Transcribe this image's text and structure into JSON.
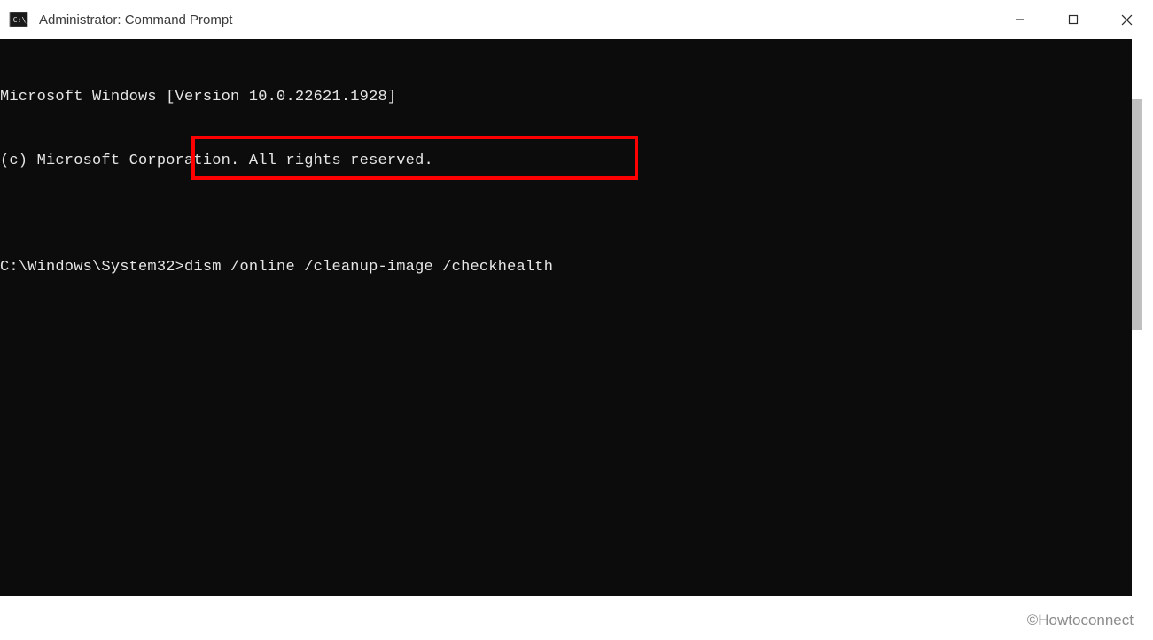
{
  "titlebar": {
    "icon_name": "cmd-icon",
    "title": "Administrator: Command Prompt"
  },
  "window_controls": {
    "minimize_name": "minimize-icon",
    "maximize_name": "maximize-icon",
    "close_name": "close-icon"
  },
  "terminal": {
    "lines": [
      "Microsoft Windows [Version 10.0.22621.1928]",
      "(c) Microsoft Corporation. All rights reserved.",
      "",
      "C:\\Windows\\System32>dism /online /cleanup-image /checkhealth"
    ],
    "prompt": "C:\\Windows\\System32>",
    "command": "dism /online /cleanup-image /checkhealth"
  },
  "highlight": {
    "color": "#ff0000",
    "target": "command"
  },
  "watermark": "©Howtoconnect",
  "colors": {
    "terminal_bg": "#0c0c0c",
    "terminal_fg": "#e6e6e6",
    "titlebar_bg": "#ffffff",
    "highlight_border": "#ff0000"
  }
}
